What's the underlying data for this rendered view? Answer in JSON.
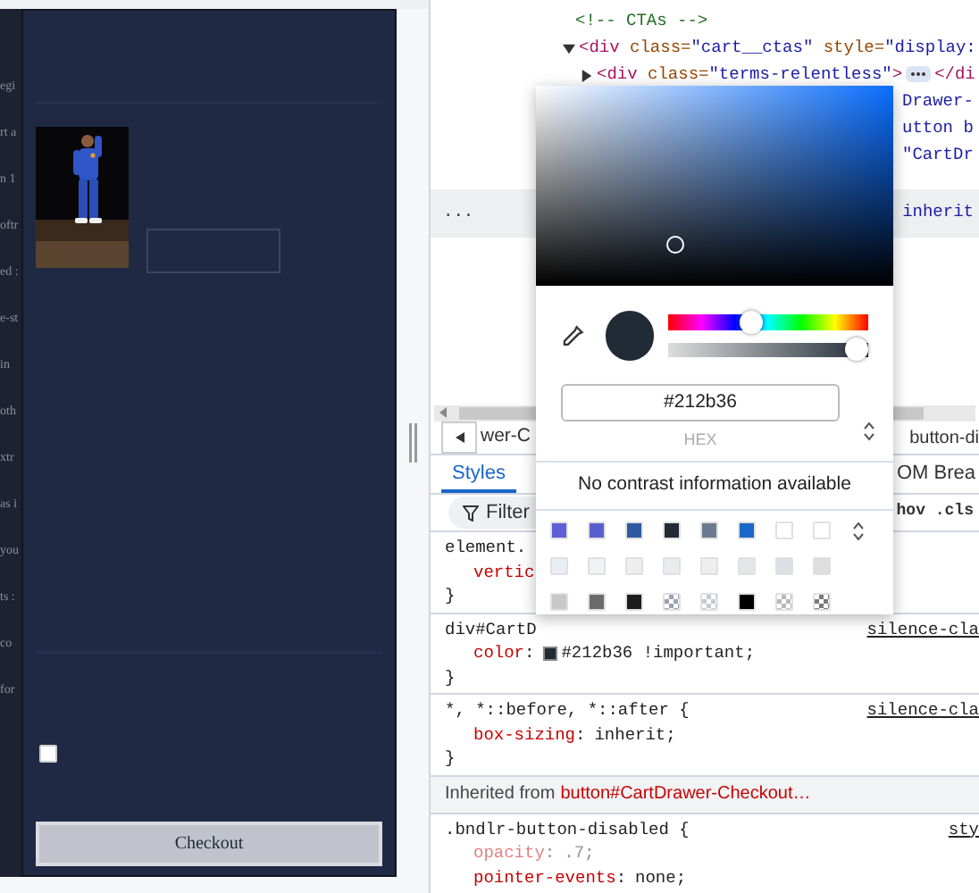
{
  "page_fragments": [
    "egi",
    "rt a",
    "n 1",
    "oftr",
    "ed :",
    "e-st",
    "in",
    "oth",
    "xtr",
    "as i",
    "you",
    "ts :",
    "co",
    "for"
  ],
  "cart": {
    "terms_checked": false,
    "checkout_button": "Checkout"
  },
  "elements": {
    "lines": [
      {
        "kind": "node",
        "tokens": [
          {
            "kind": "comment",
            "text": "<!-- CTAs -->"
          }
        ]
      },
      {
        "kind": "node",
        "expanded": true,
        "tokens": [
          {
            "kind": "tag",
            "text": "<div"
          },
          {
            "kind": "attr",
            "text": " class="
          },
          {
            "kind": "value",
            "text": "\"cart__ctas\""
          },
          {
            "kind": "attr",
            "text": " style="
          },
          {
            "kind": "value",
            "text": "\"display:"
          }
        ]
      },
      {
        "kind": "node",
        "expanded": false,
        "tokens": [
          {
            "kind": "tag",
            "text": "<div"
          },
          {
            "kind": "attr",
            "text": " class="
          },
          {
            "kind": "value",
            "text": "\"terms-relentless\""
          },
          {
            "kind": "tag",
            "text": ">"
          },
          {
            "kind": "ellipsis"
          },
          {
            "kind": "tag",
            "text": "</di"
          }
        ]
      },
      {
        "kind": "tail",
        "tokens": [
          {
            "kind": "value",
            "text": "Drawer-"
          }
        ]
      },
      {
        "kind": "tail",
        "tokens": [
          {
            "kind": "value",
            "text": "utton b"
          }
        ]
      },
      {
        "kind": "tail",
        "tokens": [
          {
            "kind": "value",
            "text": "\"CartDr"
          }
        ]
      }
    ],
    "selected_bar": {
      "dots": "...",
      "text": "inherit"
    }
  },
  "breadcrumb": {
    "left": "wer-C",
    "right": "button-di"
  },
  "tabs": [
    {
      "label": "Styles",
      "selected": true
    },
    {
      "label": "OM Brea",
      "selected": false
    }
  ],
  "filter": {
    "placeholder": "Filter",
    "toggles": "hov .cls"
  },
  "rules": [
    {
      "selector": "element.",
      "decls": [
        {
          "prop": "vertic"
        }
      ],
      "close": "}"
    },
    {
      "selector": "div#CartD",
      "source": "silence-cla",
      "decls": [
        {
          "prop": "color",
          "sep": ":",
          "value": "#212b36 !important;",
          "color": "#212b36"
        }
      ],
      "close": "}"
    },
    {
      "selector": "*, *::before, *::after {",
      "source": "silence-cla",
      "decls": [
        {
          "prop": "box-sizing",
          "sep": ":",
          "value": "inherit;"
        }
      ],
      "close": "}"
    },
    {
      "inherited": "Inherited from",
      "inherited_from": "button#CartDrawer-Checkout…"
    },
    {
      "selector": ".bndlr-button-disabled {",
      "source": "sty",
      "decls": [
        {
          "prop": "opacity",
          "sep": ":",
          "value": ".7;",
          "faded": true
        },
        {
          "prop": "pointer-events",
          "sep": ":",
          "value": "none;",
          "faded": false
        }
      ]
    }
  ],
  "picker": {
    "hue": {
      "level": 0.41
    },
    "alpha": {
      "level": 1
    },
    "preview": {
      "color": "#212b36"
    },
    "hex": "#212b36",
    "format": "HEX",
    "contrast": "No contrast information available",
    "swatches": [
      {
        "color": "#5c5fd6",
        "kind": "solid"
      },
      {
        "color": "#5a5fcf",
        "kind": "solid"
      },
      {
        "color": "#2f5aa0",
        "kind": "solid"
      },
      {
        "color": "#212b36",
        "kind": "solid"
      },
      {
        "color": "#6b7a8f",
        "kind": "solid"
      },
      {
        "color": "#1a66c9",
        "kind": "solid"
      },
      {
        "color": "#ffffff",
        "kind": "solid"
      },
      {
        "color": "#ffffff",
        "kind": "solid"
      },
      {
        "color": "#e8eef8",
        "kind": "solid"
      },
      {
        "color": "#f0f2f5",
        "kind": "solid"
      },
      {
        "color": "#eeeeee",
        "kind": "solid"
      },
      {
        "color": "#e9ebee",
        "kind": "solid"
      },
      {
        "color": "#eeeeee",
        "kind": "solid"
      },
      {
        "color": "#e3e5e8",
        "kind": "solid"
      },
      {
        "color": "#dcdfe4",
        "kind": "solid"
      },
      {
        "color": "#dedede",
        "kind": "solid"
      },
      {
        "color": "#c8c8c8",
        "kind": "solid"
      },
      {
        "color": "#6b6b6b",
        "kind": "solid"
      },
      {
        "color": "#1c1c1c",
        "kind": "solid"
      },
      {
        "color": "#9aa4b4",
        "kind": "checker"
      },
      {
        "color": "#c4cad4",
        "kind": "checker"
      },
      {
        "color": "#000000",
        "kind": "solid"
      },
      {
        "color": "#b8b8b8",
        "kind": "checker"
      },
      {
        "color": "#7a7a7a",
        "kind": "checker"
      }
    ]
  }
}
